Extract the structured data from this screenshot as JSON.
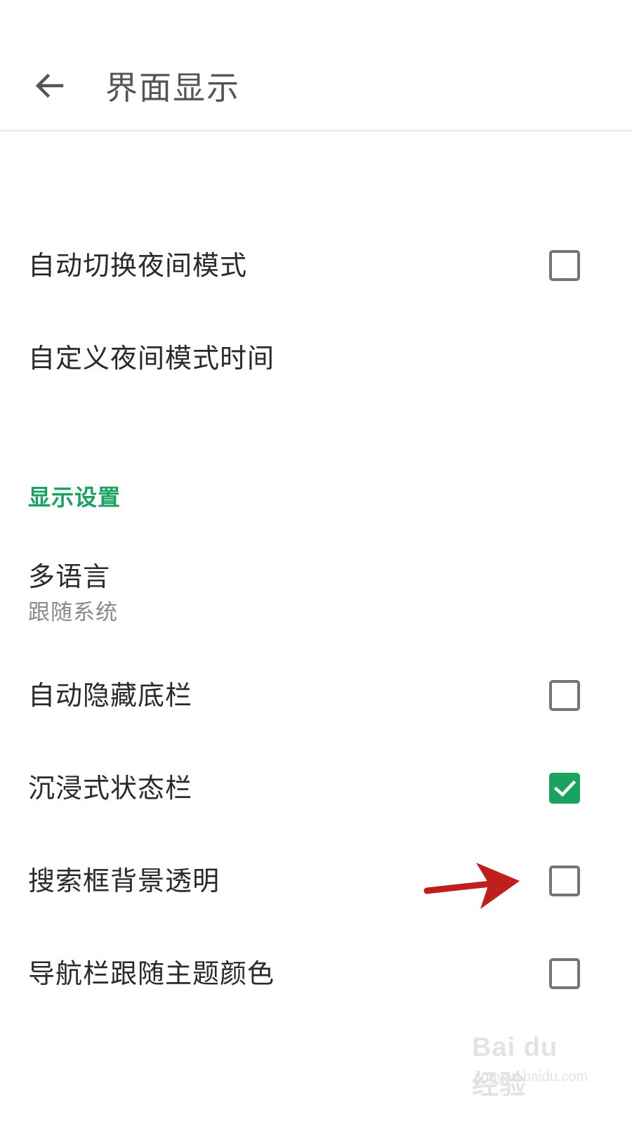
{
  "header": {
    "title": "界面显示",
    "back_icon": "arrow-left-icon"
  },
  "night_mode": {
    "auto_switch_label": "自动切换夜间模式",
    "auto_switch_checked": false,
    "custom_time_label": "自定义夜间模式时间"
  },
  "display_settings": {
    "section_title": "显示设置",
    "language": {
      "title": "多语言",
      "value": "跟随系统"
    },
    "items": [
      {
        "label": "自动隐藏底栏",
        "checked": false
      },
      {
        "label": "沉浸式状态栏",
        "checked": true
      },
      {
        "label": "搜索框背景透明",
        "checked": false
      },
      {
        "label": "导航栏跟随主题颜色",
        "checked": false
      }
    ]
  },
  "colors": {
    "accent": "#1aa260",
    "annotation_arrow": "#c0201b"
  },
  "watermark": {
    "logo_text": "Bai du 经验",
    "url": "jingyan.baidu.com"
  }
}
